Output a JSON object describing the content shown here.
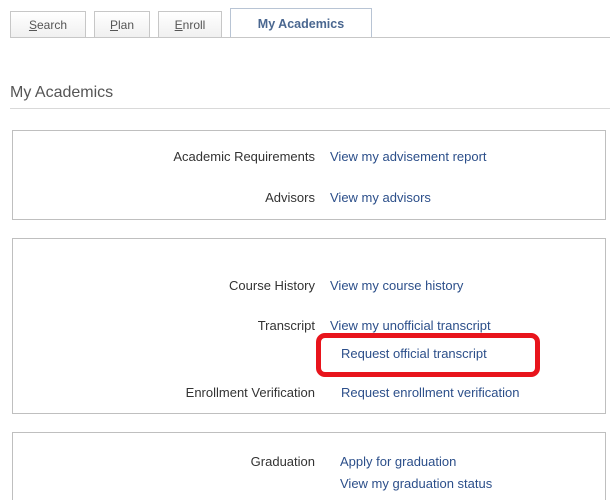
{
  "tabs": [
    {
      "label": "Search",
      "access_key": "S",
      "rest": "earch"
    },
    {
      "label": "Plan",
      "access_key": "P",
      "rest": "lan"
    },
    {
      "label": "Enroll",
      "access_key": "E",
      "rest": "nroll"
    },
    {
      "label": "My Academics",
      "active": true
    }
  ],
  "page_title": "My Academics",
  "sections": {
    "requirements": {
      "rows": [
        {
          "label": "Academic Requirements",
          "links": [
            "View my advisement report"
          ]
        },
        {
          "label": "Advisors",
          "links": [
            "View my advisors"
          ]
        }
      ]
    },
    "records": {
      "rows": [
        {
          "label": "Course History",
          "links": [
            "View my course history"
          ]
        },
        {
          "label": "Transcript",
          "links": [
            "View my unofficial transcript",
            "Request official transcript"
          ]
        },
        {
          "label": "Enrollment Verification",
          "links": [
            "Request enrollment verification"
          ]
        }
      ]
    },
    "graduation": {
      "rows": [
        {
          "label": "Graduation",
          "links": [
            "Apply for graduation",
            "View my graduation status"
          ]
        }
      ]
    }
  },
  "highlight_color": "#e8141c",
  "link_color": "#2c4f8a"
}
